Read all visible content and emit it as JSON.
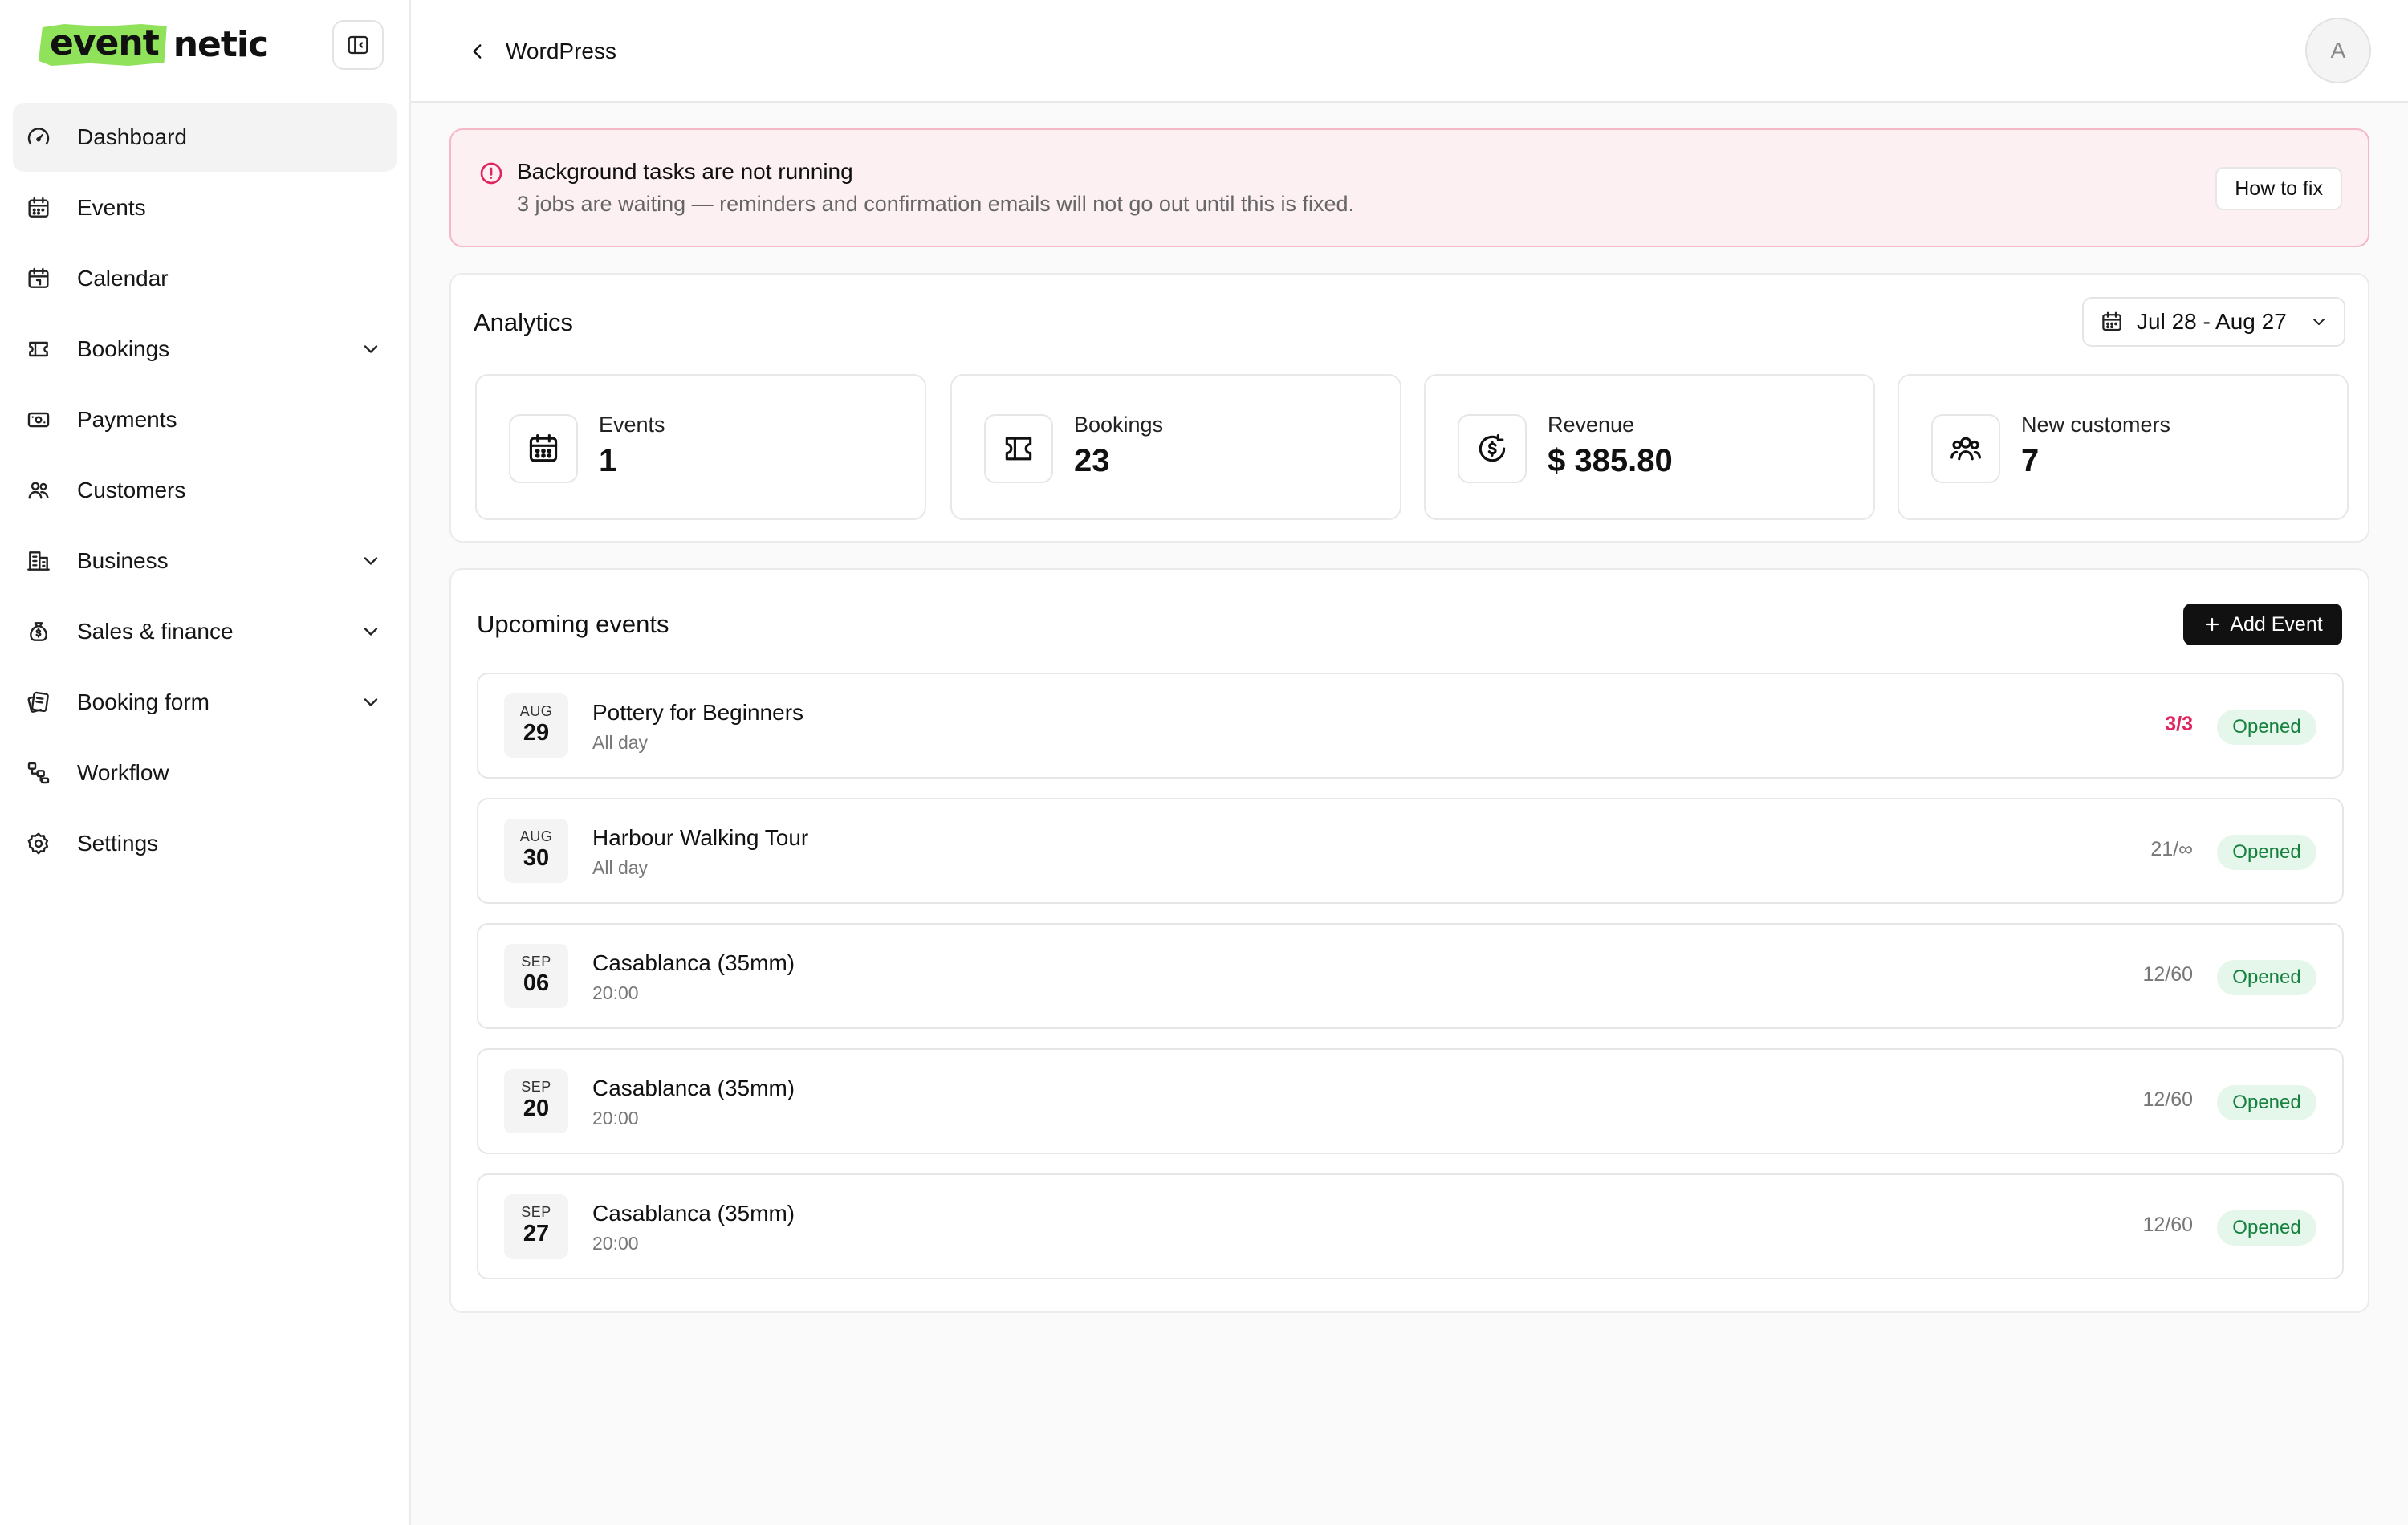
{
  "app": {
    "logo_highlight": "event",
    "logo_rest": "netic"
  },
  "sidebar": {
    "items": [
      {
        "label": "Dashboard",
        "icon": "gauge-icon",
        "active": true
      },
      {
        "label": "Events",
        "icon": "calendar-icon"
      },
      {
        "label": "Calendar",
        "icon": "calendar-day-icon"
      },
      {
        "label": "Bookings",
        "icon": "ticket-icon",
        "expandable": true
      },
      {
        "label": "Payments",
        "icon": "banknote-icon"
      },
      {
        "label": "Customers",
        "icon": "users-icon"
      },
      {
        "label": "Business",
        "icon": "building-icon",
        "expandable": true
      },
      {
        "label": "Sales & finance",
        "icon": "money-bag-icon",
        "expandable": true
      },
      {
        "label": "Booking form",
        "icon": "form-icon",
        "expandable": true
      },
      {
        "label": "Workflow",
        "icon": "workflow-icon"
      },
      {
        "label": "Settings",
        "icon": "gear-icon"
      }
    ]
  },
  "topbar": {
    "back_label": "WordPress",
    "avatar_initial": "A"
  },
  "alert": {
    "title": "Background tasks are not running",
    "description": "3 jobs are waiting — reminders and confirmation emails will not go out until this is fixed.",
    "button_label": "How to fix"
  },
  "analytics": {
    "title": "Analytics",
    "date_range": "Jul 28 - Aug 27",
    "stats": [
      {
        "label": "Events",
        "value": "1",
        "icon": "calendar-icon"
      },
      {
        "label": "Bookings",
        "value": "23",
        "icon": "ticket-icon"
      },
      {
        "label": "Revenue",
        "value": "$ 385.80",
        "icon": "dollar-refresh-icon"
      },
      {
        "label": "New customers",
        "value": "7",
        "icon": "users-icon"
      }
    ]
  },
  "upcoming": {
    "title": "Upcoming events",
    "add_button_label": "Add Event",
    "events": [
      {
        "month": "AUG",
        "day": "29",
        "title": "Pottery for Beginners",
        "time": "All day",
        "capacity": "3/3",
        "full": true,
        "status": "Opened"
      },
      {
        "month": "AUG",
        "day": "30",
        "title": "Harbour Walking Tour",
        "time": "All day",
        "capacity": "21/∞",
        "full": false,
        "status": "Opened"
      },
      {
        "month": "SEP",
        "day": "06",
        "title": "Casablanca (35mm)",
        "time": "20:00",
        "capacity": "12/60",
        "full": false,
        "status": "Opened"
      },
      {
        "month": "SEP",
        "day": "20",
        "title": "Casablanca (35mm)",
        "time": "20:00",
        "capacity": "12/60",
        "full": false,
        "status": "Opened"
      },
      {
        "month": "SEP",
        "day": "27",
        "title": "Casablanca (35mm)",
        "time": "20:00",
        "capacity": "12/60",
        "full": false,
        "status": "Opened"
      }
    ]
  },
  "colors": {
    "brand_highlight": "#8fe25a",
    "alert_bg": "#fcf0f2",
    "alert_border": "#f5b8c6",
    "alert_icon": "#e0245e",
    "status_opened_bg": "#e5f7ea",
    "status_opened_text": "#16803f",
    "capacity_full": "#e0245e",
    "primary_button": "#111111"
  }
}
